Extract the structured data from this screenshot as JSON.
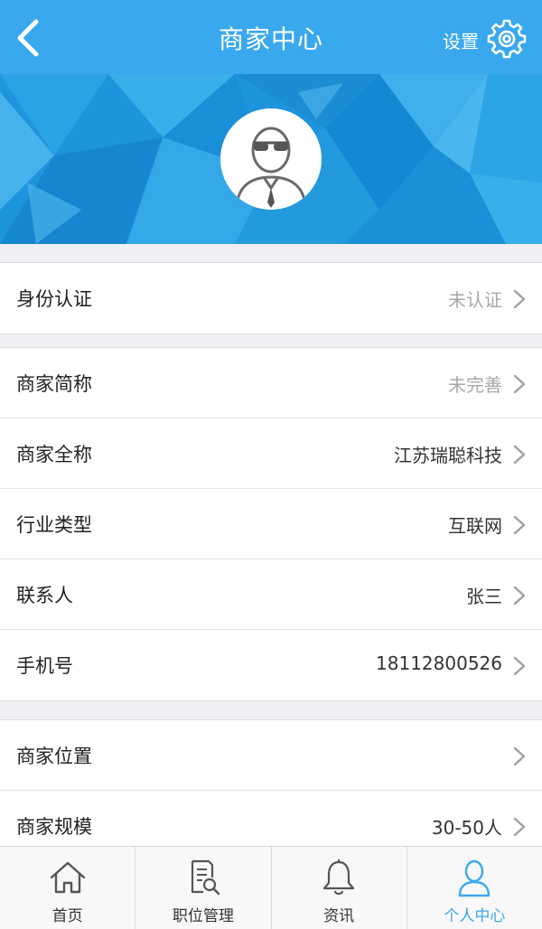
{
  "nav": {
    "title": "商家中心",
    "settings_label": "设置",
    "back_icon": "chevron-left-icon",
    "settings_icon": "gear-icon"
  },
  "profile": {
    "avatar_icon": "user-avatar-sunglasses-icon"
  },
  "groups": [
    [
      {
        "label": "身份认证",
        "value": "未认证",
        "muted": true
      }
    ],
    [
      {
        "label": "商家简称",
        "value": "未完善",
        "muted": true
      },
      {
        "label": "商家全称",
        "value": "江苏瑞聪科技",
        "muted": false
      },
      {
        "label": "行业类型",
        "value": "互联网",
        "muted": false
      },
      {
        "label": "联系人",
        "value": "张三",
        "muted": false
      },
      {
        "label": "手机号",
        "value": "18112800526",
        "muted": false
      }
    ],
    [
      {
        "label": "商家位置",
        "value": "",
        "muted": false
      },
      {
        "label": "商家规模",
        "value": "30-50人",
        "muted": false
      }
    ]
  ],
  "tabbar": {
    "tabs": [
      {
        "label": "首页",
        "icon": "home-icon",
        "active": false
      },
      {
        "label": "职位管理",
        "icon": "document-search-icon",
        "active": false
      },
      {
        "label": "资讯",
        "icon": "bell-icon",
        "active": false
      },
      {
        "label": "个人中心",
        "icon": "person-icon",
        "active": true
      }
    ]
  },
  "colors": {
    "primary": "#3aa8ee",
    "banner": "#1e94dc",
    "muted_text": "#a8a8a8",
    "background": "#efeff4"
  }
}
